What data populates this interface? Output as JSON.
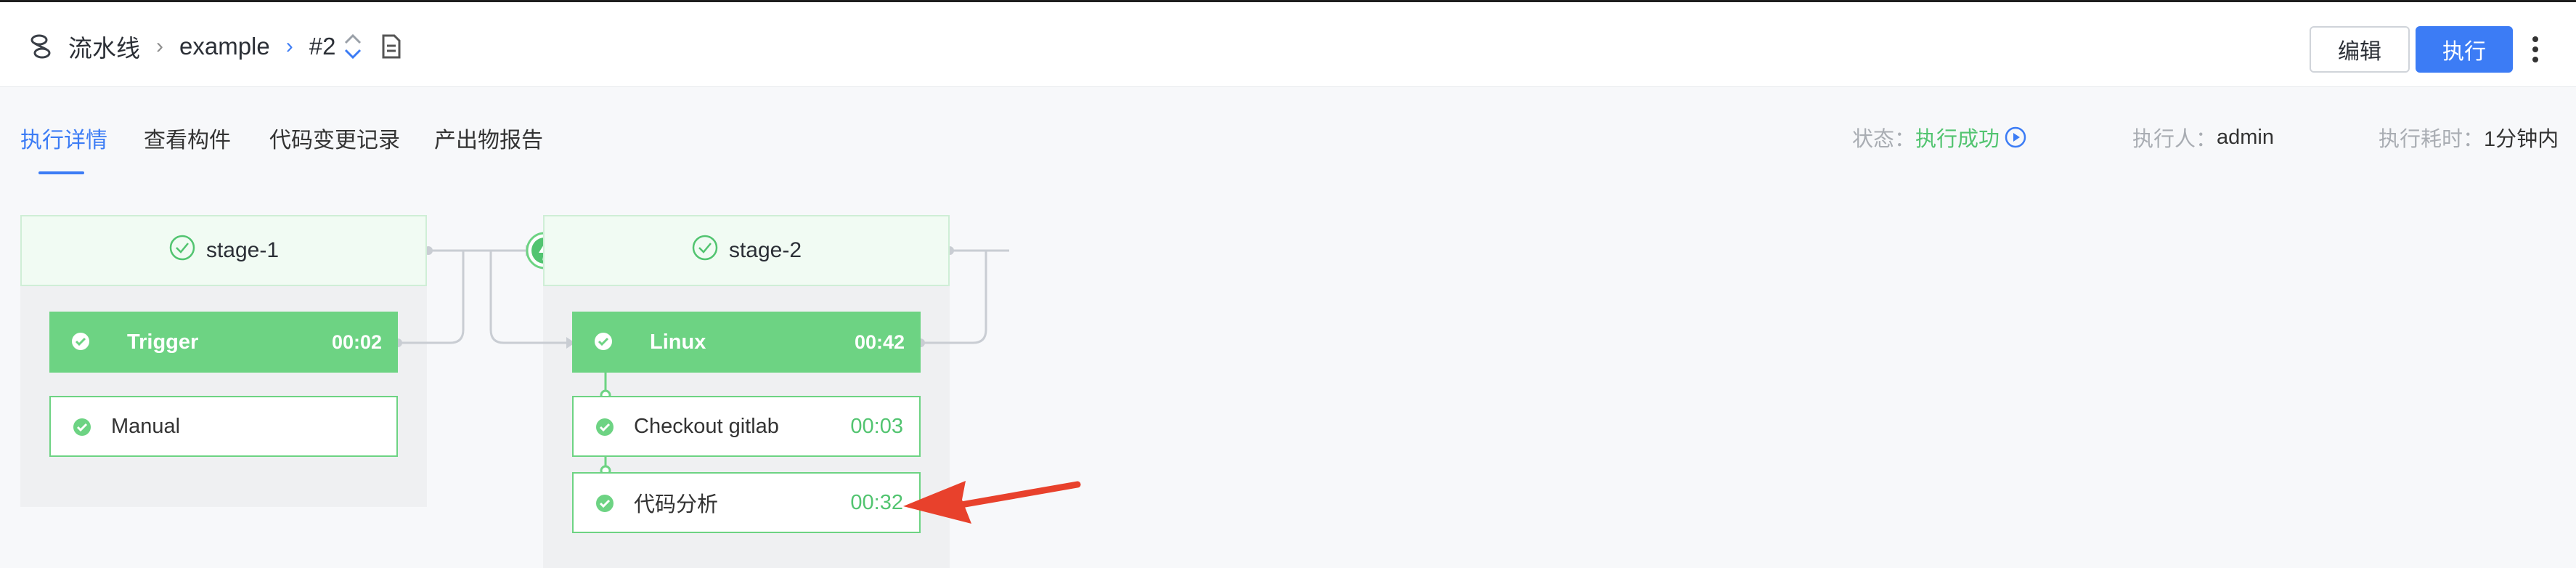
{
  "breadcrumb": {
    "root": "流水线",
    "pipeline": "example",
    "build": "#2"
  },
  "actions": {
    "edit_label": "编辑",
    "run_label": "执行"
  },
  "tabs": [
    {
      "label": "执行详情",
      "active": true
    },
    {
      "label": "查看构件",
      "active": false
    },
    {
      "label": "代码变更记录",
      "active": false
    },
    {
      "label": "产出物报告",
      "active": false
    }
  ],
  "status": {
    "status_label": "状态：",
    "status_value": "执行成功",
    "executor_label": "执行人：",
    "executor_value": "admin",
    "duration_label": "执行耗时：",
    "duration_value": "1分钟内"
  },
  "stages": [
    {
      "name": "stage-1",
      "jobs": [
        {
          "name": "Trigger",
          "time": "00:02",
          "primary": true
        },
        {
          "name": "Manual",
          "time": "",
          "primary": false
        }
      ]
    },
    {
      "name": "stage-2",
      "jobs": [
        {
          "name": "Linux",
          "time": "00:42",
          "primary": true
        },
        {
          "name": "Checkout gitlab",
          "time": "00:03",
          "primary": false
        },
        {
          "name": "代码分析",
          "time": "00:32",
          "primary": false
        }
      ]
    }
  ],
  "colors": {
    "accent": "#3c7cf5",
    "success": "#52c470",
    "job_fill": "#6dd383",
    "annotation_arrow": "#e8412c"
  }
}
